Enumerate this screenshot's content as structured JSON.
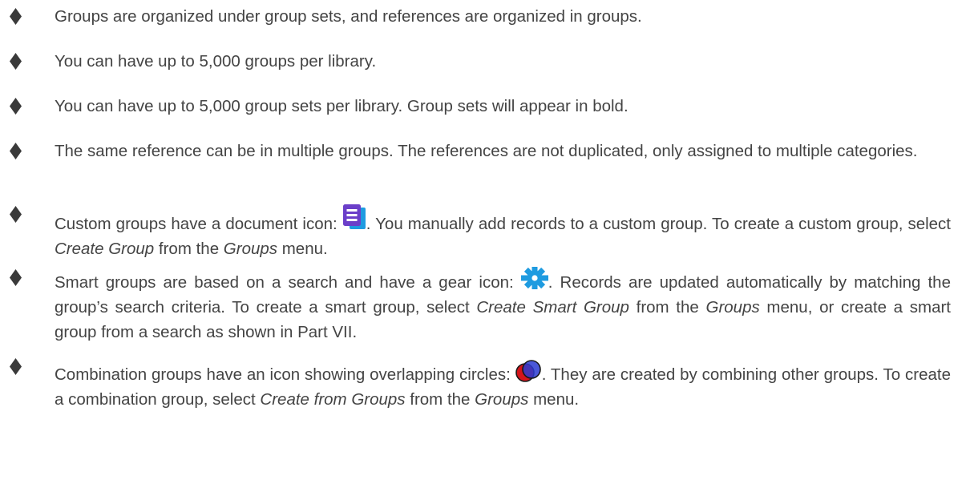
{
  "bullets": [
    {
      "text": "Groups are organized under group sets, and references are organized in groups."
    },
    {
      "text": "You can have up to 5,000 groups per library."
    },
    {
      "text": "You can have up to 5,000 group sets per library. Group sets will appear in bold."
    },
    {
      "text": "The same reference can be in multiple groups. The references are not duplicated, only assigned to multiple categories."
    },
    {
      "icon": "document-icon",
      "pre": "Custom groups have a document icon: ",
      "post1": ". You manually add records to a custom group. To create a custom group, select ",
      "em1": "Create Group",
      "mid1": " from the ",
      "em2": "Groups",
      "post2": " menu."
    },
    {
      "icon": "gear-icon",
      "pre": "Smart groups are based on a search and have a gear icon: ",
      "post1": ". Records are updated automatically by matching the group’s search criteria. To create a smart group, select ",
      "em1": "Create Smart Group",
      "mid1": " from the ",
      "em2": "Groups",
      "post2": " menu, or create a smart group from a search as shown in Part VII."
    },
    {
      "icon": "overlapping-circles-icon",
      "pre": "Combination groups have an icon showing overlapping circles: ",
      "post1": ". They are created by combining other groups. To create a combination group, select ",
      "em1": "Create from Groups",
      "mid1": " from the ",
      "em2": "Groups",
      "post2": " menu."
    }
  ],
  "colors": {
    "text": "#444444",
    "bullet": "#3a3a3a",
    "document_icon": "#6b3fc9",
    "gear_icon": "#1e9be0",
    "circle_red": "#d4141b",
    "circle_blue": "#2b3bd1"
  }
}
